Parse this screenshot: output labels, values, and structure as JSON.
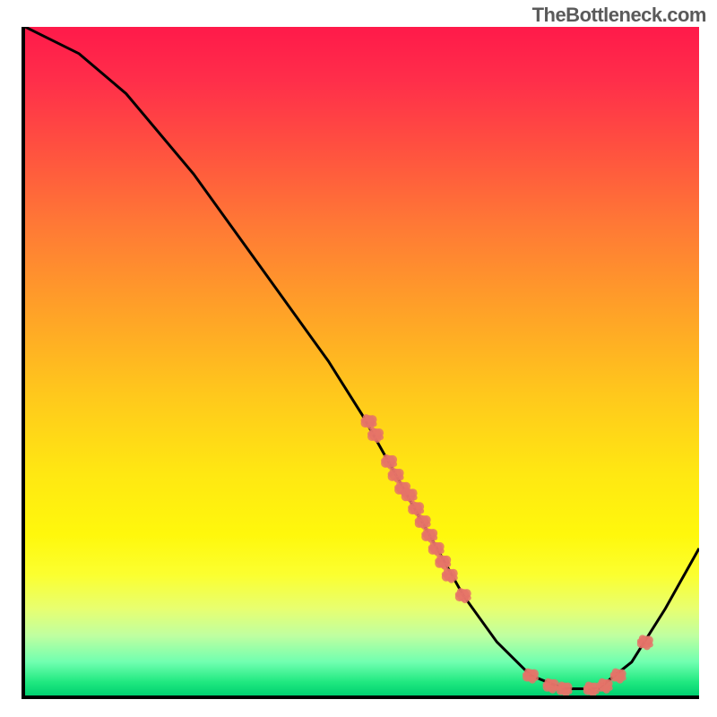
{
  "watermark": "TheBottleneck.com",
  "chart_data": {
    "type": "line",
    "title": "",
    "xlabel": "",
    "ylabel": "",
    "xlim": [
      0,
      100
    ],
    "ylim": [
      0,
      100
    ],
    "curve": [
      {
        "x": 0,
        "y": 100
      },
      {
        "x": 8,
        "y": 96
      },
      {
        "x": 15,
        "y": 90
      },
      {
        "x": 25,
        "y": 78
      },
      {
        "x": 35,
        "y": 64
      },
      {
        "x": 45,
        "y": 50
      },
      {
        "x": 50,
        "y": 42
      },
      {
        "x": 55,
        "y": 33
      },
      {
        "x": 60,
        "y": 24
      },
      {
        "x": 65,
        "y": 15
      },
      {
        "x": 70,
        "y": 8
      },
      {
        "x": 75,
        "y": 3
      },
      {
        "x": 80,
        "y": 1
      },
      {
        "x": 85,
        "y": 1
      },
      {
        "x": 90,
        "y": 5
      },
      {
        "x": 95,
        "y": 13
      },
      {
        "x": 100,
        "y": 22
      }
    ],
    "markers": [
      {
        "x": 51,
        "y": 41
      },
      {
        "x": 52,
        "y": 39
      },
      {
        "x": 54,
        "y": 35
      },
      {
        "x": 55,
        "y": 33
      },
      {
        "x": 56,
        "y": 31
      },
      {
        "x": 57,
        "y": 30
      },
      {
        "x": 58,
        "y": 28
      },
      {
        "x": 59,
        "y": 26
      },
      {
        "x": 60,
        "y": 24
      },
      {
        "x": 61,
        "y": 22
      },
      {
        "x": 62,
        "y": 20
      },
      {
        "x": 63,
        "y": 18
      },
      {
        "x": 65,
        "y": 15
      },
      {
        "x": 75,
        "y": 3
      },
      {
        "x": 78,
        "y": 1.5
      },
      {
        "x": 80,
        "y": 1
      },
      {
        "x": 84,
        "y": 1
      },
      {
        "x": 86,
        "y": 1.5
      },
      {
        "x": 88,
        "y": 3
      },
      {
        "x": 92,
        "y": 8
      }
    ],
    "marker_color": "#e57368",
    "line_color": "#000000"
  }
}
